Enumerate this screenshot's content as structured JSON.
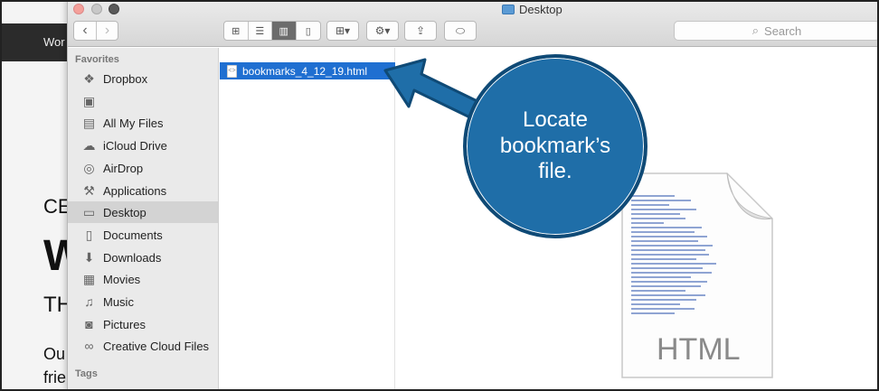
{
  "background_page": {
    "nav_text": "Wor",
    "line1": "CE",
    "line2": "W",
    "line3": "TH",
    "line4": "Ou",
    "line5": "frie"
  },
  "window": {
    "title": "Desktop",
    "search_placeholder": "Search"
  },
  "sidebar": {
    "favorites_heading": "Favorites",
    "tags_heading": "Tags",
    "items": [
      {
        "label": "Dropbox",
        "icon": "dropbox-icon"
      },
      {
        "label": "",
        "icon": "hard-drive-icon"
      },
      {
        "label": "All My Files",
        "icon": "all-files-icon"
      },
      {
        "label": "iCloud Drive",
        "icon": "cloud-icon"
      },
      {
        "label": "AirDrop",
        "icon": "airdrop-icon"
      },
      {
        "label": "Applications",
        "icon": "applications-icon"
      },
      {
        "label": "Desktop",
        "icon": "desktop-icon"
      },
      {
        "label": "Documents",
        "icon": "documents-icon"
      },
      {
        "label": "Downloads",
        "icon": "downloads-icon"
      },
      {
        "label": "Movies",
        "icon": "movies-icon"
      },
      {
        "label": "Music",
        "icon": "music-icon"
      },
      {
        "label": "Pictures",
        "icon": "pictures-icon"
      },
      {
        "label": "Creative Cloud Files",
        "icon": "creative-cloud-icon"
      }
    ]
  },
  "files": [
    {
      "name": "bookmarks_4_12_19.html"
    }
  ],
  "preview": {
    "type_label": "HTML"
  },
  "callout": {
    "text": "Locate\nbookmark’s\nfile."
  },
  "colors": {
    "selection_blue": "#1f6fd1",
    "callout_blue": "#1f6ea8"
  }
}
